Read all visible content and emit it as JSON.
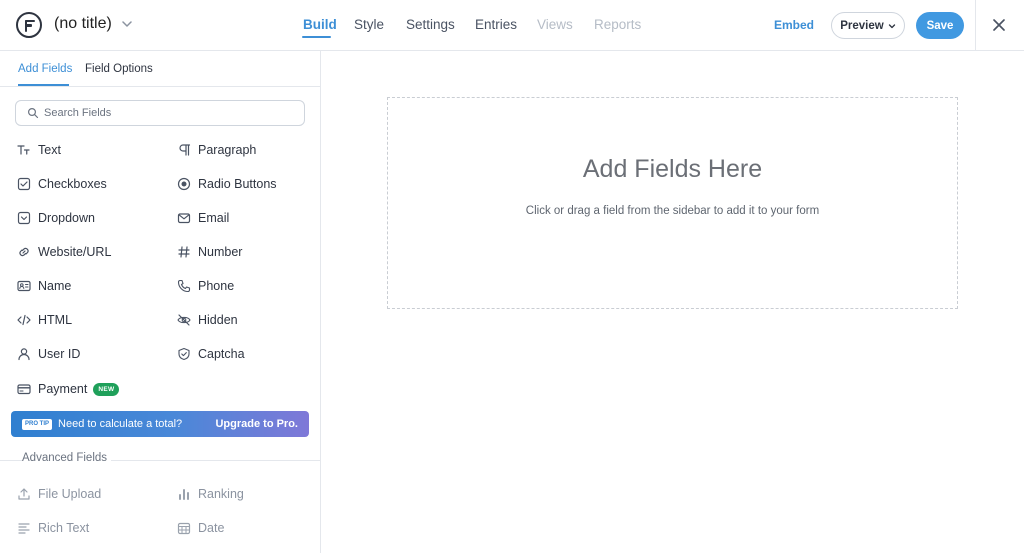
{
  "header": {
    "form_title": "(no title)",
    "nav": [
      "Build",
      "Style",
      "Settings",
      "Entries",
      "Views",
      "Reports"
    ],
    "active_nav": "Build",
    "embed_label": "Embed",
    "preview_label": "Preview",
    "save_label": "Save"
  },
  "sidebar": {
    "tabs": [
      "Add Fields",
      "Field Options"
    ],
    "search_placeholder": "Search Fields",
    "fields": [
      {
        "label": "Text",
        "icon": "text-icon"
      },
      {
        "label": "Paragraph",
        "icon": "paragraph-icon"
      },
      {
        "label": "Checkboxes",
        "icon": "checkbox-icon"
      },
      {
        "label": "Radio Buttons",
        "icon": "radio-icon"
      },
      {
        "label": "Dropdown",
        "icon": "dropdown-icon"
      },
      {
        "label": "Email",
        "icon": "email-icon"
      },
      {
        "label": "Website/URL",
        "icon": "link-icon"
      },
      {
        "label": "Number",
        "icon": "hash-icon"
      },
      {
        "label": "Name",
        "icon": "id-card-icon"
      },
      {
        "label": "Phone",
        "icon": "phone-icon"
      },
      {
        "label": "HTML",
        "icon": "code-icon"
      },
      {
        "label": "Hidden",
        "icon": "eye-off-icon"
      },
      {
        "label": "User ID",
        "icon": "user-icon"
      },
      {
        "label": "Captcha",
        "icon": "shield-check-icon"
      },
      {
        "label": "Payment",
        "icon": "credit-card-icon",
        "badge": "NEW"
      }
    ],
    "protip": {
      "badge": "PRO TIP",
      "text": "Need to calculate a total?",
      "cta": "Upgrade to Pro."
    },
    "advanced_title": "Advanced Fields",
    "advanced_fields": [
      {
        "label": "File Upload",
        "icon": "upload-icon"
      },
      {
        "label": "Ranking",
        "icon": "bar-chart-icon"
      },
      {
        "label": "Rich Text",
        "icon": "rich-text-icon"
      },
      {
        "label": "Date",
        "icon": "calendar-icon"
      }
    ]
  },
  "canvas": {
    "title": "Add Fields Here",
    "hint": "Click or drag a field from the sidebar to add it to your form"
  },
  "colors": {
    "accent": "#3d8fd6",
    "save": "#4199e1",
    "new_badge": "#1fa05a"
  }
}
